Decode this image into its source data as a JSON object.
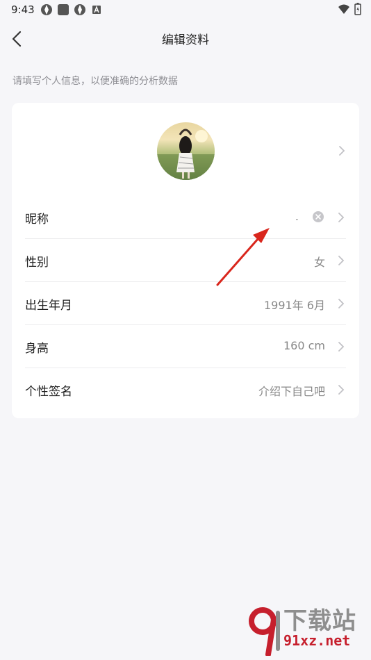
{
  "status_bar": {
    "time": "9:43"
  },
  "header": {
    "title": "编辑资料"
  },
  "hint": "请填写个人信息，以便准确的分析数据",
  "profile": {
    "rows": [
      {
        "label": "昵称",
        "value": "."
      },
      {
        "label": "性别",
        "value": "女"
      },
      {
        "label": "出生年月",
        "value": "1991年 6月"
      },
      {
        "label": "身高",
        "value": "160 cm"
      },
      {
        "label": "个性签名",
        "value": "介绍下自己吧"
      }
    ]
  },
  "watermark": {
    "main": "下载站",
    "sub": "91xz.net"
  },
  "colors": {
    "background": "#f6f6f9",
    "card": "#ffffff",
    "arrow": "#d9261c",
    "watermark_red": "#c61f2d"
  }
}
